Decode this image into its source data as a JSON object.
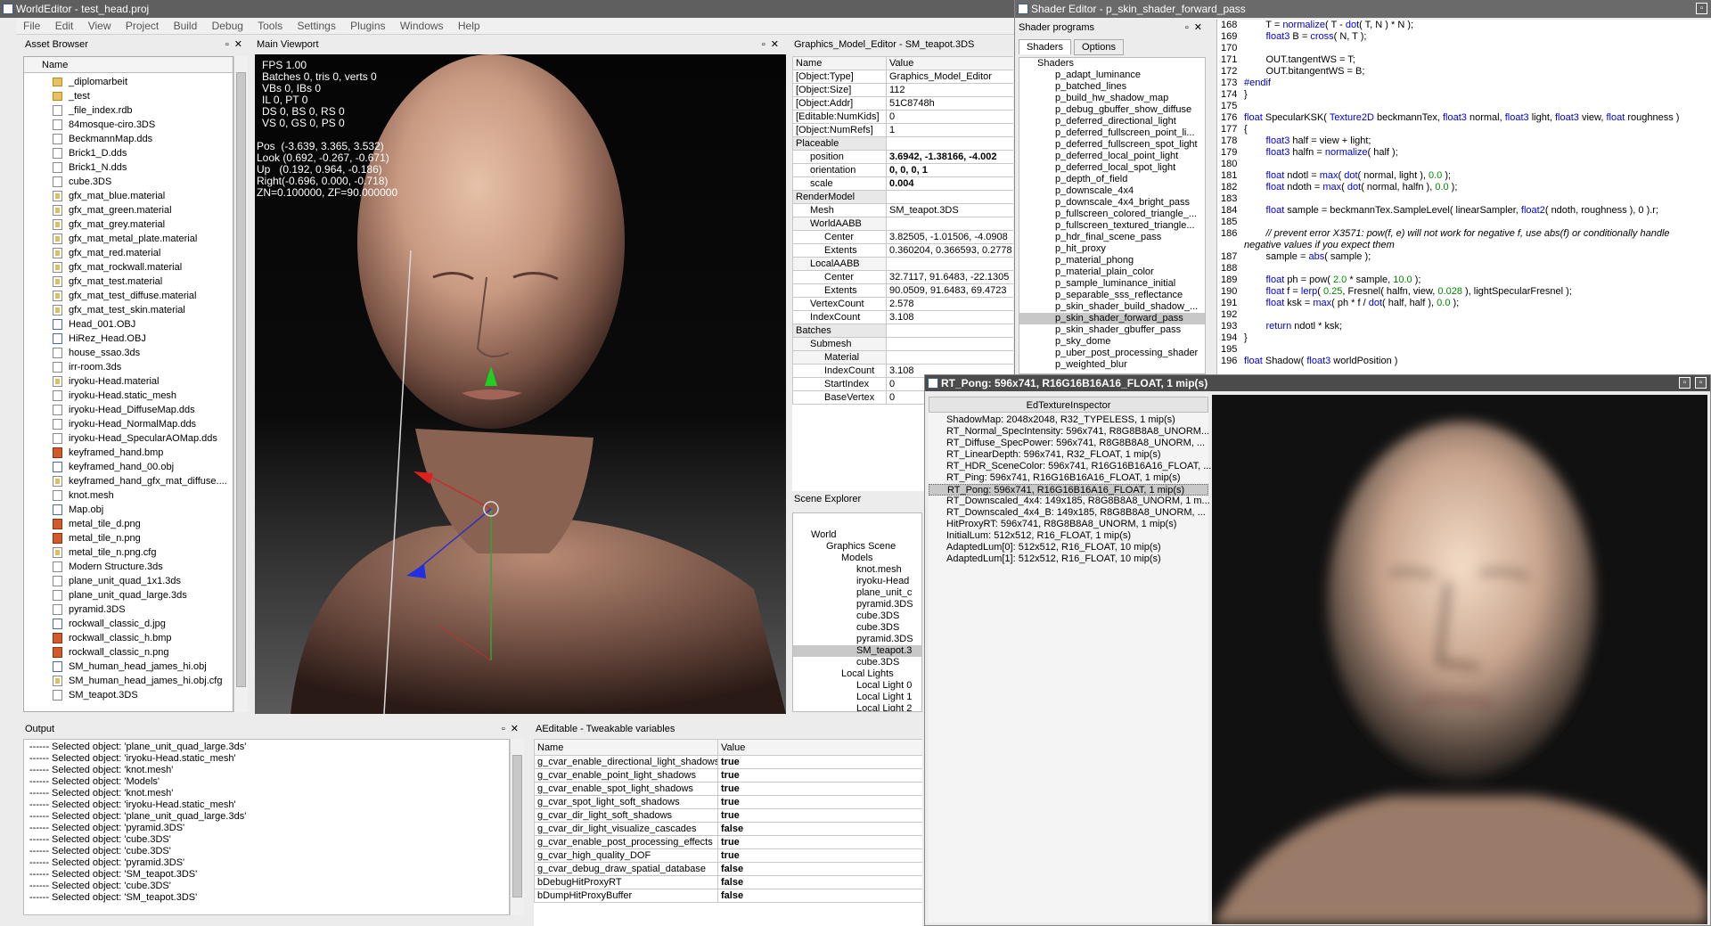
{
  "main_window": {
    "title": "WorldEditor - test_head.proj",
    "menu": [
      "File",
      "Edit",
      "View",
      "Project",
      "Build",
      "Debug",
      "Tools",
      "Settings",
      "Plugins",
      "Windows",
      "Help"
    ]
  },
  "asset_browser": {
    "title": "Asset Browser",
    "column": "Name",
    "items": [
      {
        "name": "_diplomarbeit",
        "icon": "folder"
      },
      {
        "name": "_test",
        "icon": "folder"
      },
      {
        "name": "_file_index.rdb",
        "icon": "file"
      },
      {
        "name": "84mosque-ciro.3DS",
        "icon": "file"
      },
      {
        "name": "BeckmannMap.dds",
        "icon": "file"
      },
      {
        "name": "Brick1_D.dds",
        "icon": "file"
      },
      {
        "name": "Brick1_N.dds",
        "icon": "file"
      },
      {
        "name": "cube.3DS",
        "icon": "file"
      },
      {
        "name": "gfx_mat_blue.material",
        "icon": "material"
      },
      {
        "name": "gfx_mat_green.material",
        "icon": "material"
      },
      {
        "name": "gfx_mat_grey.material",
        "icon": "material"
      },
      {
        "name": "gfx_mat_metal_plate.material",
        "icon": "material"
      },
      {
        "name": "gfx_mat_red.material",
        "icon": "material"
      },
      {
        "name": "gfx_mat_rockwall.material",
        "icon": "material"
      },
      {
        "name": "gfx_mat_test.material",
        "icon": "material"
      },
      {
        "name": "gfx_mat_test_diffuse.material",
        "icon": "material"
      },
      {
        "name": "gfx_mat_test_skin.material",
        "icon": "material"
      },
      {
        "name": "Head_001.OBJ",
        "icon": "obj"
      },
      {
        "name": "HiRez_Head.OBJ",
        "icon": "obj"
      },
      {
        "name": "house_ssao.3ds",
        "icon": "file"
      },
      {
        "name": "irr-room.3ds",
        "icon": "file"
      },
      {
        "name": "iryoku-Head.material",
        "icon": "material"
      },
      {
        "name": "iryoku-Head.static_mesh",
        "icon": "file"
      },
      {
        "name": "iryoku-Head_DiffuseMap.dds",
        "icon": "file"
      },
      {
        "name": "iryoku-Head_NormalMap.dds",
        "icon": "file"
      },
      {
        "name": "iryoku-Head_SpecularAOMap.dds",
        "icon": "file"
      },
      {
        "name": "keyframed_hand.bmp",
        "icon": "image"
      },
      {
        "name": "keyframed_hand_00.obj",
        "icon": "obj"
      },
      {
        "name": "keyframed_hand_gfx_mat_diffuse....",
        "icon": "material"
      },
      {
        "name": "knot.mesh",
        "icon": "file"
      },
      {
        "name": "Map.obj",
        "icon": "obj"
      },
      {
        "name": "metal_tile_d.png",
        "icon": "image"
      },
      {
        "name": "metal_tile_n.png",
        "icon": "image"
      },
      {
        "name": "metal_tile_n.png.cfg",
        "icon": "material"
      },
      {
        "name": "Modern Structure.3ds",
        "icon": "file"
      },
      {
        "name": "plane_unit_quad_1x1.3ds",
        "icon": "file"
      },
      {
        "name": "plane_unit_quad_large.3ds",
        "icon": "file"
      },
      {
        "name": "pyramid.3DS",
        "icon": "file"
      },
      {
        "name": "rockwall_classic_d.jpg",
        "icon": "obj"
      },
      {
        "name": "rockwall_classic_h.bmp",
        "icon": "image"
      },
      {
        "name": "rockwall_classic_n.png",
        "icon": "image"
      },
      {
        "name": "SM_human_head_james_hi.obj",
        "icon": "obj"
      },
      {
        "name": "SM_human_head_james_hi.obj.cfg",
        "icon": "material"
      },
      {
        "name": "SM_teapot.3DS",
        "icon": "file"
      }
    ]
  },
  "viewport": {
    "title": "Main Viewport",
    "stats": "FPS 1.00\nBatches 0, tris 0, verts 0\nVBs 0, IBs 0\nIL 0, PT 0\nDS 0, BS 0, RS 0\nVS 0, GS 0, PS 0",
    "camera": "Pos  (-3.639, 3.365, 3.532)\nLook (0.692, -0.267, -0.671)\nUp   (0.192, 0.964, -0.186)\nRight(-0.696, 0.000, -0.718)\nZN=0.100000, ZF=90.000000"
  },
  "model_editor": {
    "title": "Graphics_Model_Editor - SM_teapot.3DS",
    "col_name": "Name",
    "col_value": "Value",
    "rows": [
      {
        "name": "[Object:Type]",
        "value": "Graphics_Model_Editor",
        "indent": 0,
        "bold": false
      },
      {
        "name": "[Object:Size]",
        "value": "112",
        "indent": 0,
        "bold": false
      },
      {
        "name": "[Object:Addr]",
        "value": "51C8748h",
        "indent": 0,
        "bold": false
      },
      {
        "name": "[Editable:NumKids]",
        "value": "0",
        "indent": 0,
        "bold": false
      },
      {
        "name": "[Object:NumRefs]",
        "value": "1",
        "indent": 0,
        "bold": false
      },
      {
        "name": "Placeable",
        "value": "",
        "indent": 0,
        "bold": false
      },
      {
        "name": "position",
        "value": "3.6942, -1.38166, -4.002",
        "indent": 1,
        "bold": true
      },
      {
        "name": "orientation",
        "value": "0, 0, 0, 1",
        "indent": 1,
        "bold": true
      },
      {
        "name": "scale",
        "value": "0.004",
        "indent": 1,
        "bold": true
      },
      {
        "name": "RenderModel",
        "value": "",
        "indent": 0,
        "bold": false
      },
      {
        "name": "Mesh",
        "value": "SM_teapot.3DS",
        "indent": 1,
        "bold": false
      },
      {
        "name": "WorldAABB",
        "value": "",
        "indent": 1,
        "bold": false
      },
      {
        "name": "Center",
        "value": "3.82505, -1.01506, -4.0908",
        "indent": 2,
        "bold": false
      },
      {
        "name": "Extents",
        "value": "0.360204, 0.366593, 0.2778",
        "indent": 2,
        "bold": false
      },
      {
        "name": "LocalAABB",
        "value": "",
        "indent": 1,
        "bold": false
      },
      {
        "name": "Center",
        "value": "32.7117, 91.6483, -22.1305",
        "indent": 2,
        "bold": false
      },
      {
        "name": "Extents",
        "value": "90.0509, 91.6483, 69.4723",
        "indent": 2,
        "bold": false
      },
      {
        "name": "VertexCount",
        "value": "2.578",
        "indent": 1,
        "bold": false
      },
      {
        "name": "IndexCount",
        "value": "3.108",
        "indent": 1,
        "bold": false
      },
      {
        "name": "Batches",
        "value": "",
        "indent": 0,
        "bold": false
      },
      {
        "name": "Submesh",
        "value": "",
        "indent": 1,
        "bold": false
      },
      {
        "name": "Material",
        "value": "",
        "indent": 2,
        "bold": false
      },
      {
        "name": "IndexCount",
        "value": "3.108",
        "indent": 2,
        "bold": false
      },
      {
        "name": "StartIndex",
        "value": "0",
        "indent": 2,
        "bold": false
      },
      {
        "name": "BaseVertex",
        "value": "0",
        "indent": 2,
        "bold": false
      }
    ]
  },
  "scene_explorer": {
    "title": "Scene Explorer",
    "items": [
      {
        "label": "World",
        "level": 0
      },
      {
        "label": "Graphics Scene",
        "level": 1
      },
      {
        "label": "Models",
        "level": 2
      },
      {
        "label": "knot.mesh",
        "level": 3
      },
      {
        "label": "iryoku-Head",
        "level": 3
      },
      {
        "label": "plane_unit_c",
        "level": 3
      },
      {
        "label": "pyramid.3DS",
        "level": 3
      },
      {
        "label": "cube.3DS",
        "level": 3
      },
      {
        "label": "cube.3DS",
        "level": 3
      },
      {
        "label": "pyramid.3DS",
        "level": 3
      },
      {
        "label": "SM_teapot.3",
        "level": 3,
        "selected": true
      },
      {
        "label": "cube.3DS",
        "level": 3
      },
      {
        "label": "Local Lights",
        "level": 2
      },
      {
        "label": "Local Light 0",
        "level": 3
      },
      {
        "label": "Local Light 1",
        "level": 3
      },
      {
        "label": "Local Light 2",
        "level": 3
      }
    ]
  },
  "output": {
    "title": "Output",
    "lines": [
      "------ Selected object: 'plane_unit_quad_large.3ds'",
      "------ Selected object: 'iryoku-Head.static_mesh'",
      "------ Selected object: 'knot.mesh'",
      "------ Selected object: 'Models'",
      "------ Selected object: 'knot.mesh'",
      "------ Selected object: 'iryoku-Head.static_mesh'",
      "------ Selected object: 'plane_unit_quad_large.3ds'",
      "------ Selected object: 'pyramid.3DS'",
      "------ Selected object: 'cube.3DS'",
      "------ Selected object: 'cube.3DS'",
      "------ Selected object: 'pyramid.3DS'",
      "------ Selected object: 'SM_teapot.3DS'",
      "------ Selected object: 'cube.3DS'",
      "------ Selected object: 'SM_teapot.3DS'"
    ]
  },
  "tweakables": {
    "title": "AEditable - Tweakable variables",
    "col_name": "Name",
    "col_value": "Value",
    "rows": [
      {
        "name": "g_cvar_enable_directional_light_shadows",
        "value": "true"
      },
      {
        "name": "g_cvar_enable_point_light_shadows",
        "value": "true"
      },
      {
        "name": "g_cvar_enable_spot_light_shadows",
        "value": "true"
      },
      {
        "name": "g_cvar_spot_light_soft_shadows",
        "value": "true"
      },
      {
        "name": "g_cvar_dir_light_soft_shadows",
        "value": "true"
      },
      {
        "name": "g_cvar_dir_light_visualize_cascades",
        "value": "false"
      },
      {
        "name": "g_cvar_enable_post_processing_effects",
        "value": "true"
      },
      {
        "name": "g_cvar_high_quality_DOF",
        "value": "true"
      },
      {
        "name": "g_cvar_debug_draw_spatial_database",
        "value": "false"
      },
      {
        "name": "bDebugHitProxyRT",
        "value": "false"
      },
      {
        "name": "bDumpHitProxyBuffer",
        "value": "false"
      }
    ]
  },
  "shader_editor": {
    "title": "Shader Editor - p_skin_shader_forward_pass",
    "programs_title": "Shader programs",
    "tabs": [
      "Shaders",
      "Options"
    ],
    "root": "Shaders",
    "shaders": [
      "p_adapt_luminance",
      "p_batched_lines",
      "p_build_hw_shadow_map",
      "p_debug_gbuffer_show_diffuse",
      "p_deferred_directional_light",
      "p_deferred_fullscreen_point_li...",
      "p_deferred_fullscreen_spot_light",
      "p_deferred_local_point_light",
      "p_deferred_local_spot_light",
      "p_depth_of_field",
      "p_downscale_4x4",
      "p_downscale_4x4_bright_pass",
      "p_fullscreen_colored_triangle_...",
      "p_fullscreen_textured_triangle...",
      "p_hdr_final_scene_pass",
      "p_hit_proxy",
      "p_material_phong",
      "p_material_plain_color",
      "p_sample_luminance_initial",
      "p_separable_sss_reflectance",
      "p_skin_shader_build_shadow_...",
      "p_skin_shader_forward_pass",
      "p_skin_shader_gbuffer_pass",
      "p_sky_dome",
      "p_uber_post_processing_shader",
      "p_weighted_blur"
    ],
    "selected": "p_skin_shader_forward_pass",
    "code": [
      {
        "n": "168",
        "t": "        T = normalize( T - dot( T, N ) * N );"
      },
      {
        "n": "169",
        "t": "        float3 B = cross( N, T );"
      },
      {
        "n": "170",
        "t": ""
      },
      {
        "n": "171",
        "t": "        OUT.tangentWS = T;"
      },
      {
        "n": "172",
        "t": "        OUT.bitangentWS = B;"
      },
      {
        "n": "173",
        "t": "#endif"
      },
      {
        "n": "174",
        "t": "}"
      },
      {
        "n": "175",
        "t": ""
      },
      {
        "n": "176",
        "t": "float SpecularKSK( Texture2D beckmannTex, float3 normal, float3 light, float3 view, float roughness )"
      },
      {
        "n": "177",
        "t": "{"
      },
      {
        "n": "178",
        "t": "        float3 half = view + light;"
      },
      {
        "n": "179",
        "t": "        float3 halfn = normalize( half );"
      },
      {
        "n": "180",
        "t": ""
      },
      {
        "n": "181",
        "t": "        float ndotl = max( dot( normal, light ), 0.0 );"
      },
      {
        "n": "182",
        "t": "        float ndoth = max( dot( normal, halfn ), 0.0 );"
      },
      {
        "n": "183",
        "t": ""
      },
      {
        "n": "184",
        "t": "        float sample = beckmannTex.SampleLevel( linearSampler, float2( ndoth, roughness ), 0 ).r;"
      },
      {
        "n": "185",
        "t": ""
      },
      {
        "n": "186",
        "t": "        // prevent error X3571: pow(f, e) will not work for negative f, use abs(f) or conditionally handle"
      },
      {
        "n": "",
        "t": "negative values if you expect them"
      },
      {
        "n": "187",
        "t": "        sample = abs( sample );"
      },
      {
        "n": "188",
        "t": ""
      },
      {
        "n": "189",
        "t": "        float ph = pow( 2.0 * sample, 10.0 );"
      },
      {
        "n": "190",
        "t": "        float f = lerp( 0.25, Fresnel( halfn, view, 0.028 ), lightSpecularFresnel );"
      },
      {
        "n": "191",
        "t": "        float ksk = max( ph * f / dot( half, half ), 0.0 );"
      },
      {
        "n": "192",
        "t": ""
      },
      {
        "n": "193",
        "t": "        return ndotl * ksk;"
      },
      {
        "n": "194",
        "t": "}"
      },
      {
        "n": "195",
        "t": ""
      },
      {
        "n": "196",
        "t": "float Shadow( float3 worldPosition )"
      }
    ]
  },
  "rt_window": {
    "title": "RT_Pong: 596x741, R16G16B16A16_FLOAT, 1 mip(s)",
    "inspector_title": "EdTextureInspector",
    "textures": [
      "ShadowMap: 2048x2048, R32_TYPELESS, 1 mip(s)",
      "RT_Normal_SpecIntensity: 596x741, R8G8B8A8_UNORM...",
      "RT_Diffuse_SpecPower: 596x741, R8G8B8A8_UNORM, ...",
      "RT_LinearDepth: 596x741, R32_FLOAT, 1 mip(s)",
      "RT_HDR_SceneColor: 596x741, R16G16B16A16_FLOAT, ...",
      "RT_Ping: 596x741, R16G16B16A16_FLOAT, 1 mip(s)",
      "RT_Pong: 596x741, R16G16B16A16_FLOAT, 1 mip(s)",
      "RT_Downscaled_4x4: 149x185, R8G8B8A8_UNORM, 1 m...",
      "RT_Downscaled_4x4_B: 149x185, R8G8B8A8_UNORM, ...",
      "HitProxyRT: 596x741, R8G8B8A8_UNORM, 1 mip(s)",
      "InitialLum: 512x512, R16_FLOAT, 1 mip(s)",
      "AdaptedLum[0]: 512x512, R16_FLOAT, 10 mip(s)",
      "AdaptedLum[1]: 512x512, R16_FLOAT, 10 mip(s)"
    ],
    "selected": "RT_Pong: 596x741, R16G16B16A16_FLOAT, 1 mip(s)"
  }
}
